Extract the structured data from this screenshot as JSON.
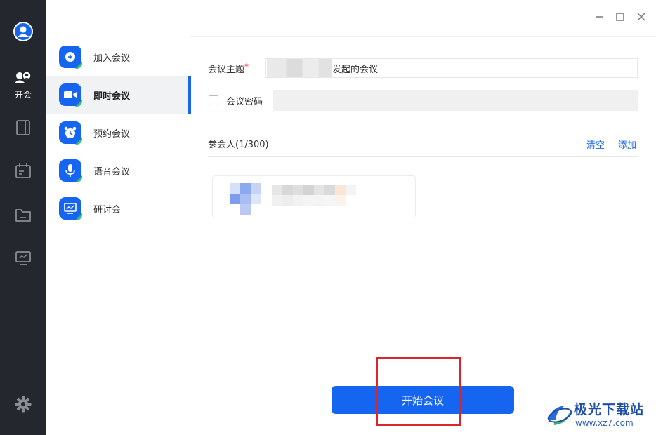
{
  "rail": {
    "items": [
      {
        "label": "开会",
        "icon": "meeting-icon"
      },
      {
        "label": "",
        "icon": "notebook-icon"
      },
      {
        "label": "",
        "icon": "calendar-icon"
      },
      {
        "label": "",
        "icon": "folder-icon"
      },
      {
        "label": "",
        "icon": "screen-share-icon"
      },
      {
        "label": "",
        "icon": "settings-gear-icon"
      }
    ]
  },
  "menu": {
    "items": [
      {
        "label": "加入会议",
        "icon": "join-plus-icon"
      },
      {
        "label": "即时会议",
        "icon": "video-camera-icon",
        "active": true
      },
      {
        "label": "预约会议",
        "icon": "alarm-clock-icon"
      },
      {
        "label": "语音会议",
        "icon": "microphone-icon"
      },
      {
        "label": "研讨会",
        "icon": "presentation-icon"
      }
    ]
  },
  "form": {
    "subject_label": "会议主题",
    "required_mark": "*",
    "subject_value": "发起的会议",
    "password_label": "会议密码",
    "participants_label": "参会人(1/300)",
    "clear_label": "清空",
    "add_label": "添加"
  },
  "start_button_label": "开始会议",
  "watermark": {
    "title": "极光下载站",
    "url": "www.xz7.com"
  },
  "colors": {
    "accent": "#1565f0",
    "rail_bg": "#24272e",
    "highlight": "#d9262c"
  }
}
